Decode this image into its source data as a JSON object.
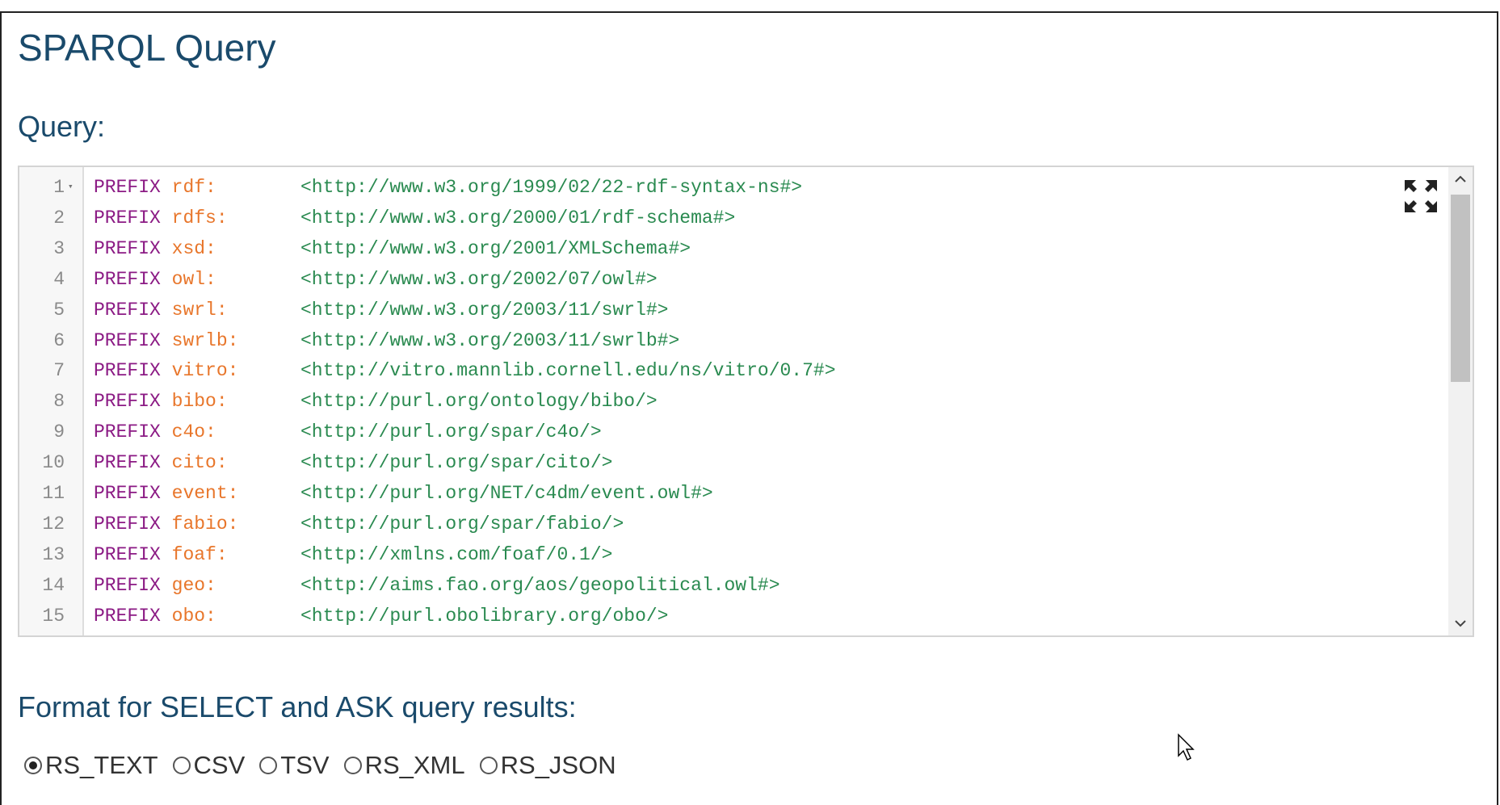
{
  "page": {
    "title": "SPARQL Query",
    "query_label": "Query:",
    "format_label": "Format for SELECT and ASK query results:"
  },
  "editor": {
    "expand_icon": "expand-icon",
    "lines": [
      {
        "num": "1",
        "keyword": "PREFIX",
        "prefix": "rdf:",
        "uri": "<http://www.w3.org/1999/02/22-rdf-syntax-ns#>"
      },
      {
        "num": "2",
        "keyword": "PREFIX",
        "prefix": "rdfs:",
        "uri": "<http://www.w3.org/2000/01/rdf-schema#>"
      },
      {
        "num": "3",
        "keyword": "PREFIX",
        "prefix": "xsd:",
        "uri": "<http://www.w3.org/2001/XMLSchema#>"
      },
      {
        "num": "4",
        "keyword": "PREFIX",
        "prefix": "owl:",
        "uri": "<http://www.w3.org/2002/07/owl#>"
      },
      {
        "num": "5",
        "keyword": "PREFIX",
        "prefix": "swrl:",
        "uri": "<http://www.w3.org/2003/11/swrl#>"
      },
      {
        "num": "6",
        "keyword": "PREFIX",
        "prefix": "swrlb:",
        "uri": "<http://www.w3.org/2003/11/swrlb#>"
      },
      {
        "num": "7",
        "keyword": "PREFIX",
        "prefix": "vitro:",
        "uri": "<http://vitro.mannlib.cornell.edu/ns/vitro/0.7#>"
      },
      {
        "num": "8",
        "keyword": "PREFIX",
        "prefix": "bibo:",
        "uri": "<http://purl.org/ontology/bibo/>"
      },
      {
        "num": "9",
        "keyword": "PREFIX",
        "prefix": "c4o:",
        "uri": "<http://purl.org/spar/c4o/>"
      },
      {
        "num": "10",
        "keyword": "PREFIX",
        "prefix": "cito:",
        "uri": "<http://purl.org/spar/cito/>"
      },
      {
        "num": "11",
        "keyword": "PREFIX",
        "prefix": "event:",
        "uri": "<http://purl.org/NET/c4dm/event.owl#>"
      },
      {
        "num": "12",
        "keyword": "PREFIX",
        "prefix": "fabio:",
        "uri": "<http://purl.org/spar/fabio/>"
      },
      {
        "num": "13",
        "keyword": "PREFIX",
        "prefix": "foaf:",
        "uri": "<http://xmlns.com/foaf/0.1/>"
      },
      {
        "num": "14",
        "keyword": "PREFIX",
        "prefix": "geo:",
        "uri": "<http://aims.fao.org/aos/geopolitical.owl#>"
      },
      {
        "num": "15",
        "keyword": "PREFIX",
        "prefix": "obo:",
        "uri": "<http://purl.obolibrary.org/obo/>"
      }
    ]
  },
  "format_options": [
    {
      "label": "RS_TEXT",
      "checked": true
    },
    {
      "label": "CSV",
      "checked": false
    },
    {
      "label": "TSV",
      "checked": false
    },
    {
      "label": "RS_XML",
      "checked": false
    },
    {
      "label": "RS_JSON",
      "checked": false
    }
  ],
  "colors": {
    "heading": "#1a4a6b",
    "keyword": "#8b1a84",
    "prefix": "#e8762b",
    "uri": "#2a8a50"
  }
}
